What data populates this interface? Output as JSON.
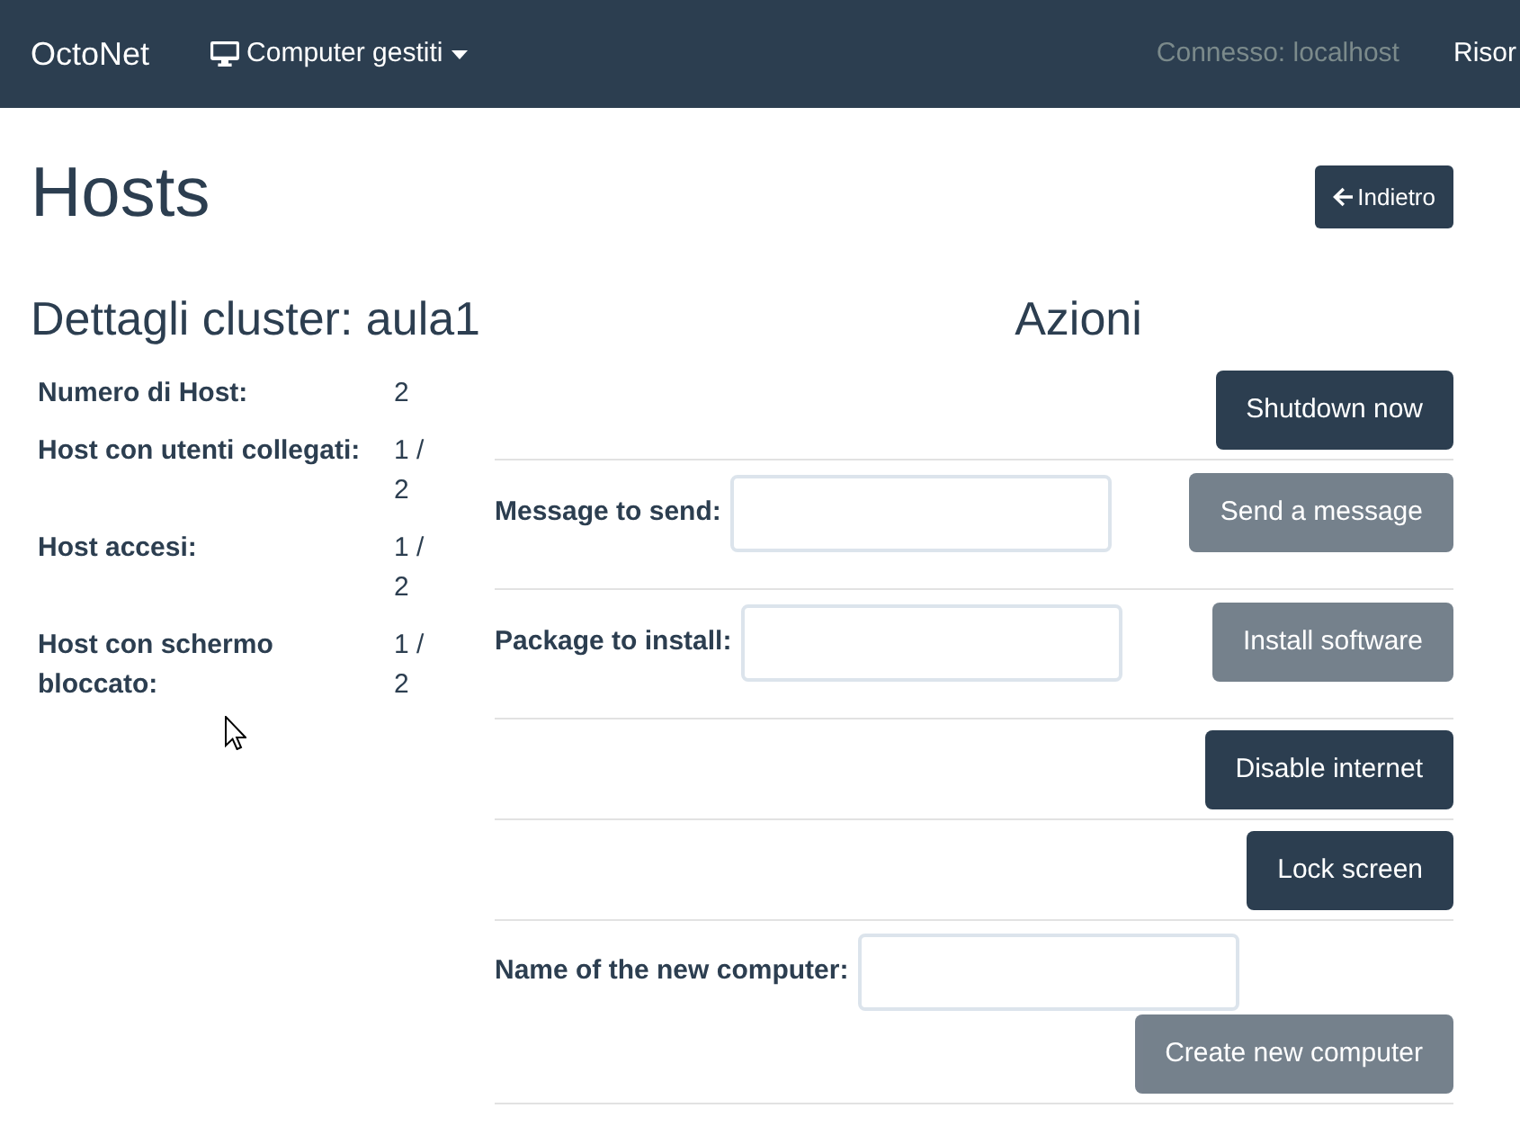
{
  "navbar": {
    "brand": "OctoNet",
    "menu": "Computer gestiti",
    "status": "Connesso: localhost",
    "link": "Risor"
  },
  "page": {
    "title": "Hosts",
    "back_button": "Indietro"
  },
  "cluster": {
    "title": "Dettagli cluster: aula1",
    "rows": [
      {
        "label": "Numero di Host:",
        "value": "2"
      },
      {
        "label": "Host con utenti collegati:",
        "value": "1 / 2"
      },
      {
        "label": "Host accesi:",
        "value": "1 / 2"
      },
      {
        "label": "Host con schermo bloccato:",
        "value": "1 / 2"
      }
    ]
  },
  "actions": {
    "title": "Azioni",
    "rows": [
      {
        "kind": "button",
        "button": {
          "label": "Shutdown now",
          "disabled": false
        }
      },
      {
        "kind": "inline_form",
        "label": "Message to send:",
        "button": {
          "label": "Send a message",
          "disabled": true
        }
      },
      {
        "kind": "inline_form",
        "label": "Package to install:",
        "button": {
          "label": "Install software",
          "disabled": true
        }
      },
      {
        "kind": "button",
        "button": {
          "label": "Disable internet",
          "disabled": false
        }
      },
      {
        "kind": "button",
        "button": {
          "label": "Lock screen",
          "disabled": false
        }
      },
      {
        "kind": "stacked_form",
        "label": "Name of the new computer:",
        "button": {
          "label": "Create new computer",
          "disabled": true
        }
      }
    ]
  }
}
